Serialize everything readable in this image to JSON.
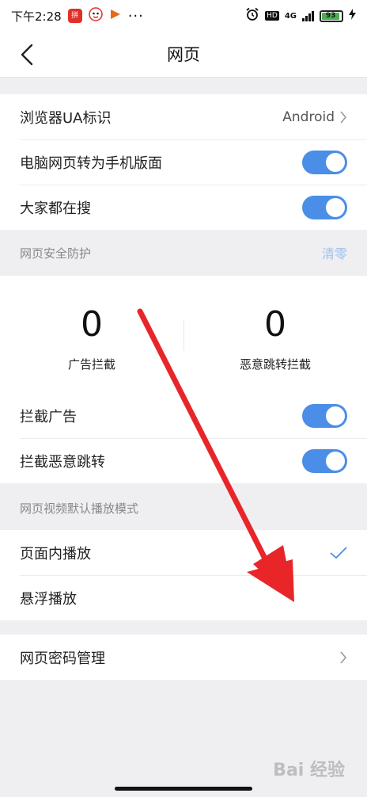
{
  "statusbar": {
    "time": "下午2:28",
    "app_badge": "拼",
    "network": "4G",
    "hd": "HD",
    "battery": "93",
    "battery_level": 0.93
  },
  "header": {
    "title": "网页"
  },
  "settings_top": {
    "ua_label": "浏览器UA标识",
    "ua_value": "Android",
    "desktop_to_mobile_label": "电脑网页转为手机版面",
    "desktop_to_mobile_on": true,
    "trending_label": "大家都在搜",
    "trending_on": true
  },
  "security": {
    "header": "网页安全防护",
    "clear_label": "清零",
    "ad_block_count": "0",
    "ad_block_label": "广告拦截",
    "redirect_block_count": "0",
    "redirect_block_label": "恶意跳转拦截",
    "block_ads_label": "拦截广告",
    "block_ads_on": true,
    "block_redirect_label": "拦截恶意跳转",
    "block_redirect_on": true
  },
  "video": {
    "header": "网页视频默认播放模式",
    "inline_label": "页面内播放",
    "inline_selected": true,
    "float_label": "悬浮播放"
  },
  "password": {
    "label": "网页密码管理"
  },
  "watermark": "Bai 经验",
  "colors": {
    "accent": "#4a8ee8",
    "annotation_arrow": "#e8262a",
    "background": "#efeff1"
  }
}
